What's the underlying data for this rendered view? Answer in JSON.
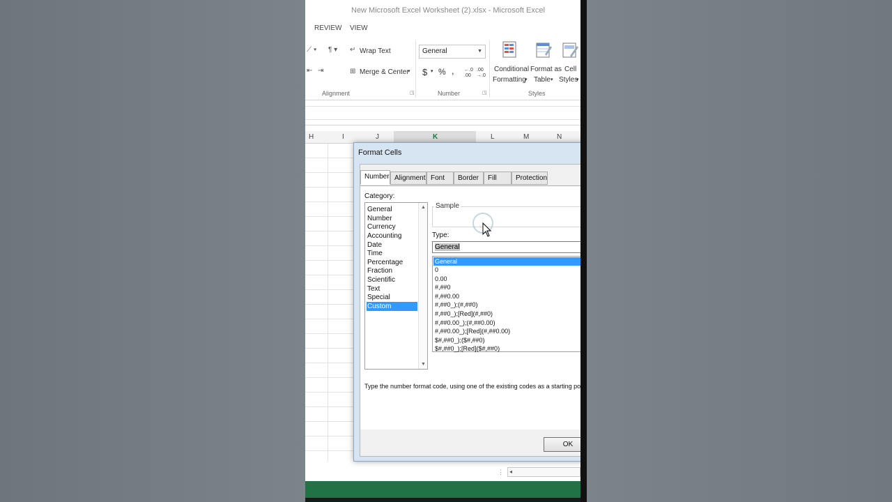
{
  "window": {
    "title": "New Microsoft Excel Worksheet (2).xlsx - Microsoft Excel"
  },
  "ribbon_tabs": [
    "REVIEW",
    "VIEW"
  ],
  "ribbon": {
    "alignment": {
      "wrap_text": "Wrap Text",
      "merge_center": "Merge & Center",
      "group_label": "Alignment"
    },
    "number": {
      "format_value": "General",
      "currency": "$",
      "percent": "%",
      "comma": ",",
      "increase_decimal": "←.0 .00",
      "decrease_decimal": ".00 →.0",
      "group_label": "Number"
    },
    "styles": {
      "conditional_formatting_line1": "Conditional",
      "conditional_formatting_line2": "Formatting",
      "format_as_table_line1": "Format as",
      "format_as_table_line2": "Table",
      "cell_styles_line1": "Cell",
      "cell_styles_line2": "Styles",
      "group_label": "Styles"
    }
  },
  "columns": [
    "H",
    "I",
    "J",
    "K",
    "L",
    "M",
    "N"
  ],
  "selected_column": "K",
  "dialog": {
    "title": "Format Cells",
    "tabs": [
      "Number",
      "Alignment",
      "Font",
      "Border",
      "Fill",
      "Protection"
    ],
    "active_tab": "Number",
    "category_label": "Category:",
    "categories": [
      "General",
      "Number",
      "Currency",
      "Accounting",
      "Date",
      "Time",
      "Percentage",
      "Fraction",
      "Scientific",
      "Text",
      "Special",
      "Custom"
    ],
    "selected_category": "Custom",
    "sample_label": "Sample",
    "type_label": "Type:",
    "type_value": "General",
    "type_options": [
      "General",
      "0",
      "0.00",
      "#,##0",
      "#,##0.00",
      "#,##0_);(#,##0)",
      "#,##0_);[Red](#,##0)",
      "#,##0.00_);(#,##0.00)",
      "#,##0.00_);[Red](#,##0.00)",
      "$#,##0_);($#,##0)",
      "$#,##0_);[Red]($#,##0)"
    ],
    "selected_type": "General",
    "description": "Type the number format code, using one of the existing codes as a starting point.",
    "ok_label": "OK"
  },
  "colors": {
    "accent_green": "#217346",
    "selection_blue": "#3399ff"
  }
}
